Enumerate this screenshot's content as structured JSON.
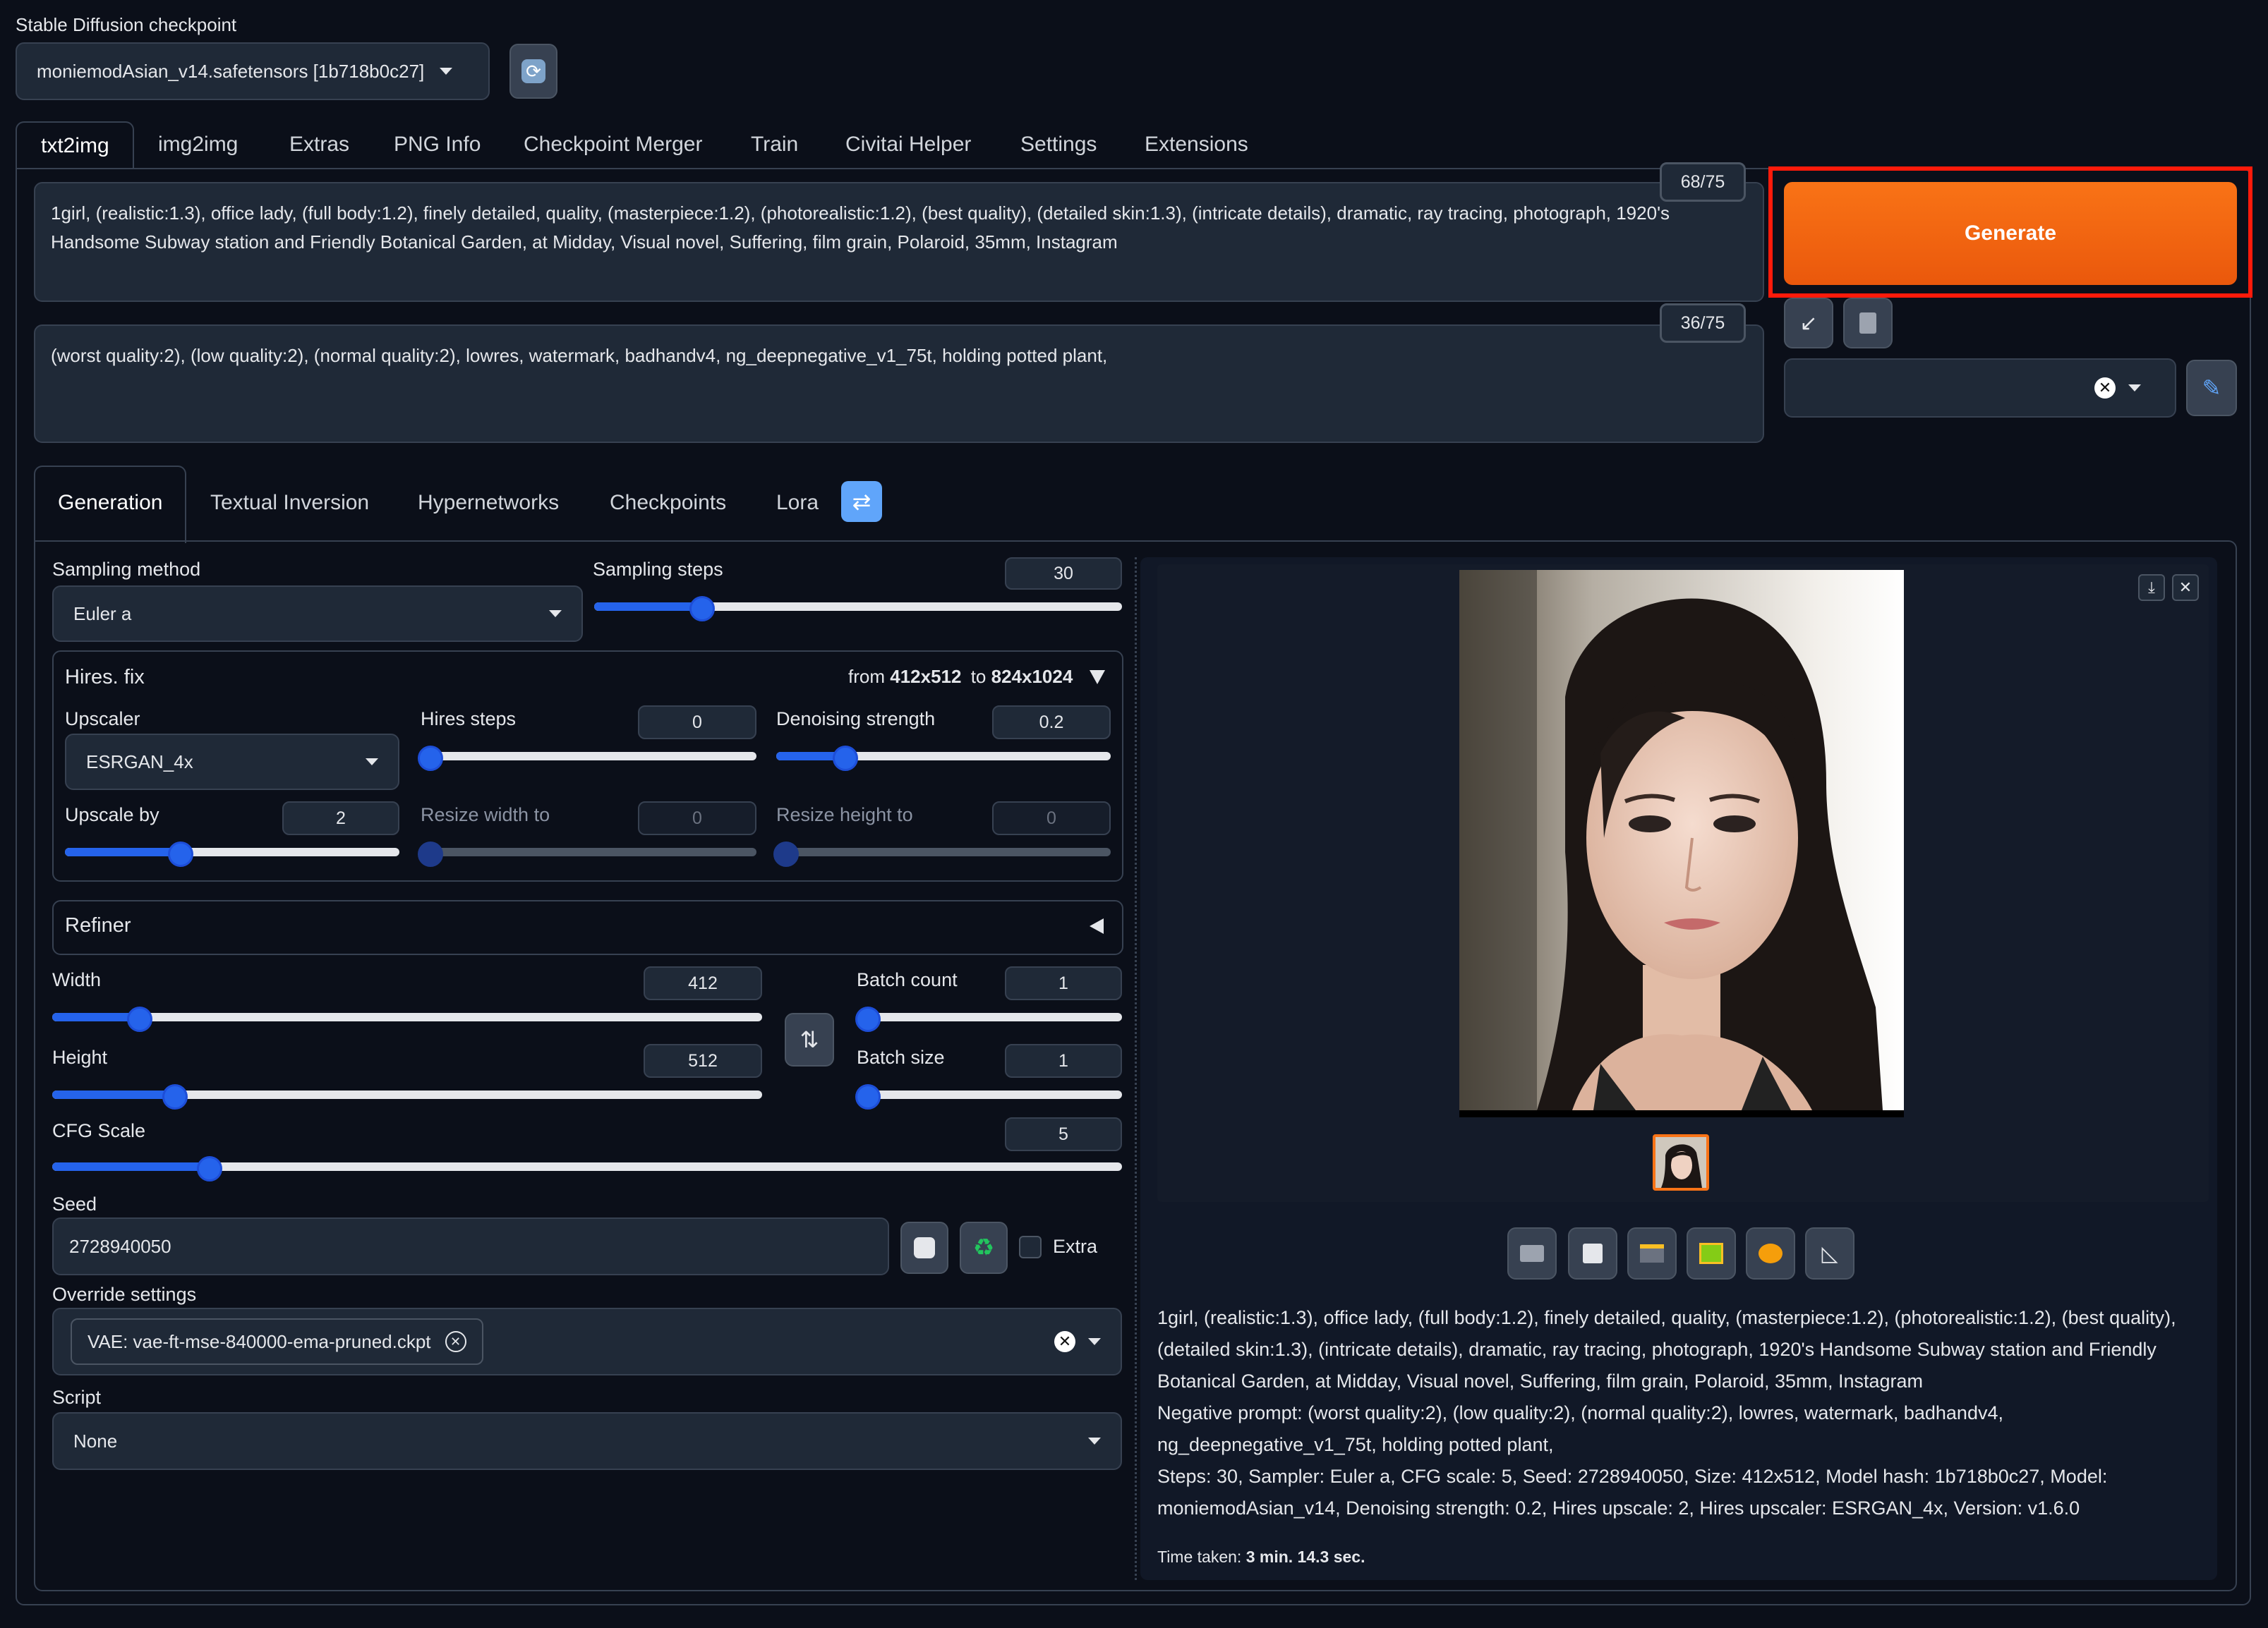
{
  "checkpoint": {
    "label": "Stable Diffusion checkpoint",
    "value": "moniemodAsian_v14.safetensors [1b718b0c27]"
  },
  "main_tabs": [
    "txt2img",
    "img2img",
    "Extras",
    "PNG Info",
    "Checkpoint Merger",
    "Train",
    "Civitai Helper",
    "Settings",
    "Extensions"
  ],
  "prompt": {
    "positive": "1girl, (realistic:1.3), office lady, (full body:1.2), finely detailed, quality, (masterpiece:1.2), (photorealistic:1.2), (best quality), (detailed skin:1.3), (intricate details), dramatic, ray tracing, photograph, 1920's Handsome Subway station and Friendly Botanical Garden, at Midday, Visual novel, Suffering, film grain, Polaroid, 35mm, Instagram",
    "positive_count": "68/75",
    "negative": "(worst quality:2), (low quality:2), (normal quality:2), lowres, watermark, badhandv4, ng_deepnegative_v1_75t, holding potted plant,",
    "negative_count": "36/75"
  },
  "generate_label": "Generate",
  "sub_tabs": [
    "Generation",
    "Textual Inversion",
    "Hypernetworks",
    "Checkpoints",
    "Lora"
  ],
  "sampling": {
    "method_label": "Sampling method",
    "method_value": "Euler a",
    "steps_label": "Sampling steps",
    "steps_value": "30",
    "steps_fraction": 0.2
  },
  "hires": {
    "title": "Hires. fix",
    "from_label": "from",
    "from_value": "412x512",
    "to_label": "to",
    "to_value": "824x1024",
    "upscaler_label": "Upscaler",
    "upscaler_value": "ESRGAN_4x",
    "steps_label": "Hires steps",
    "steps_value": "0",
    "denoise_label": "Denoising strength",
    "denoise_value": "0.2",
    "upscale_by_label": "Upscale by",
    "upscale_by_value": "2",
    "resize_w_label": "Resize width to",
    "resize_w_value": "0",
    "resize_h_label": "Resize height to",
    "resize_h_value": "0"
  },
  "refiner_title": "Refiner",
  "dims": {
    "width_label": "Width",
    "width_value": "412",
    "height_label": "Height",
    "height_value": "512",
    "batch_count_label": "Batch count",
    "batch_count_value": "1",
    "batch_size_label": "Batch size",
    "batch_size_value": "1",
    "cfg_label": "CFG Scale",
    "cfg_value": "5"
  },
  "seed": {
    "label": "Seed",
    "value": "2728940050",
    "extra_label": "Extra"
  },
  "override": {
    "label": "Override settings",
    "chip": "VAE: vae-ft-mse-840000-ema-pruned.ckpt"
  },
  "script": {
    "label": "Script",
    "value": "None"
  },
  "output": {
    "info_prompt": "1girl, (realistic:1.3), office lady, (full body:1.2), finely detailed, quality, (masterpiece:1.2), (photorealistic:1.2), (best quality), (detailed skin:1.3), (intricate details), dramatic, ray tracing, photograph, 1920's Handsome Subway station and Friendly Botanical Garden, at Midday, Visual novel, Suffering, film grain, Polaroid, 35mm, Instagram",
    "info_negative": "Negative prompt: (worst quality:2), (low quality:2), (normal quality:2), lowres, watermark, badhandv4, ng_deepnegative_v1_75t, holding potted plant,",
    "info_params": "Steps: 30, Sampler: Euler a, CFG scale: 5, Seed: 2728940050, Size: 412x512, Model hash: 1b718b0c27, Model: moniemodAsian_v14, Denoising strength: 0.2, Hires upscale: 2, Hires upscaler: ESRGAN_4x, Version: v1.6.0",
    "time_label": "Time taken:",
    "time_value": "3 min. 14.3 sec."
  },
  "colors": {
    "generate": "#f97316",
    "highlight": "#ff1a0a",
    "accent": "#2563eb"
  }
}
